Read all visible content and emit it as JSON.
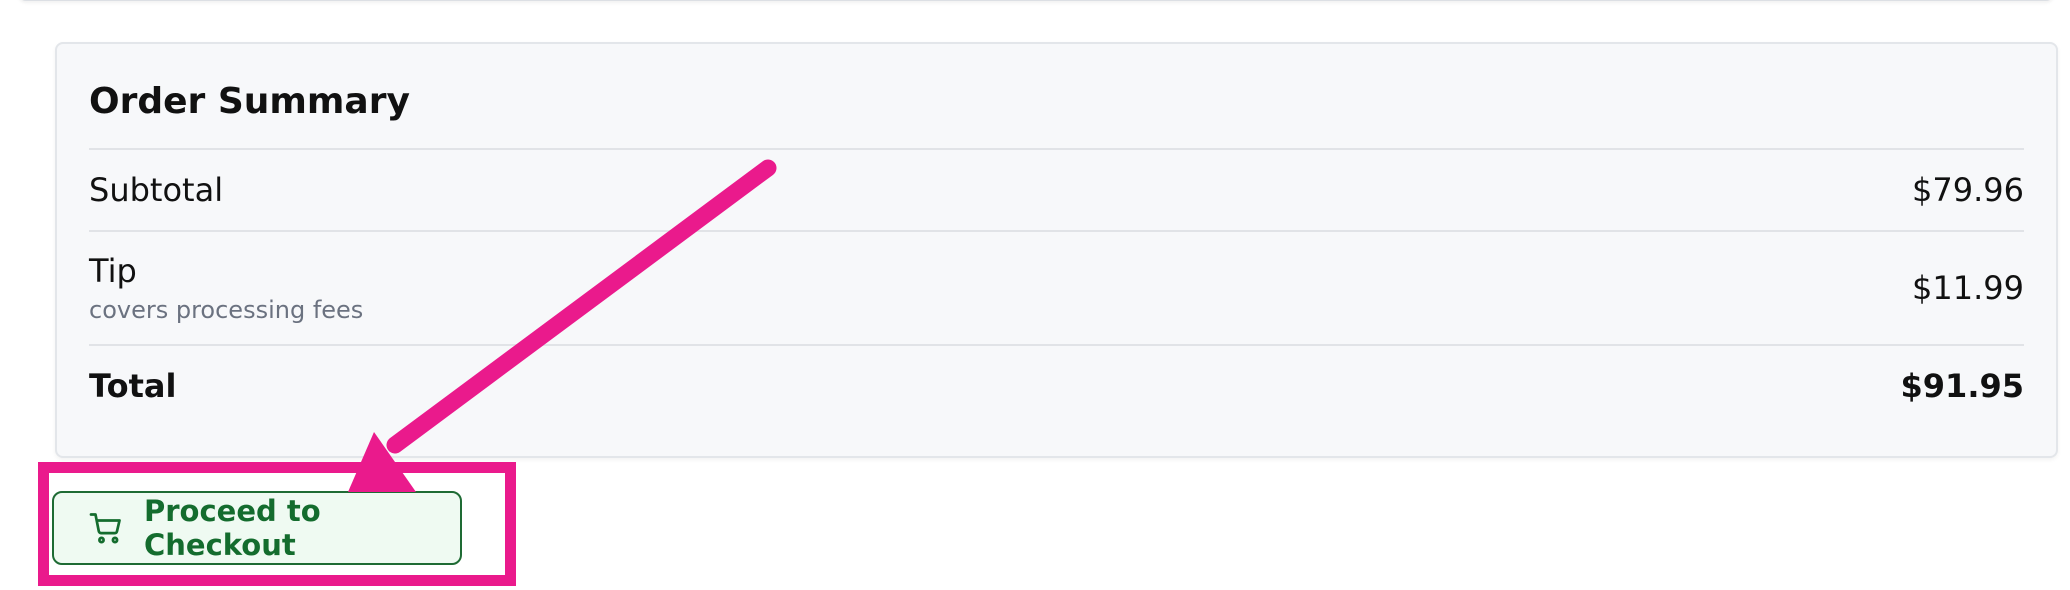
{
  "order_summary": {
    "title": "Order Summary",
    "rows": [
      {
        "label": "Subtotal",
        "value": "$79.96"
      },
      {
        "label": "Tip",
        "note": "covers processing fees",
        "value": "$11.99"
      },
      {
        "label": "Total",
        "value": "$91.95"
      }
    ]
  },
  "checkout": {
    "button_label": "Proceed to Checkout",
    "icon": "cart-icon"
  },
  "annotation": {
    "color": "#ea1a8c"
  }
}
